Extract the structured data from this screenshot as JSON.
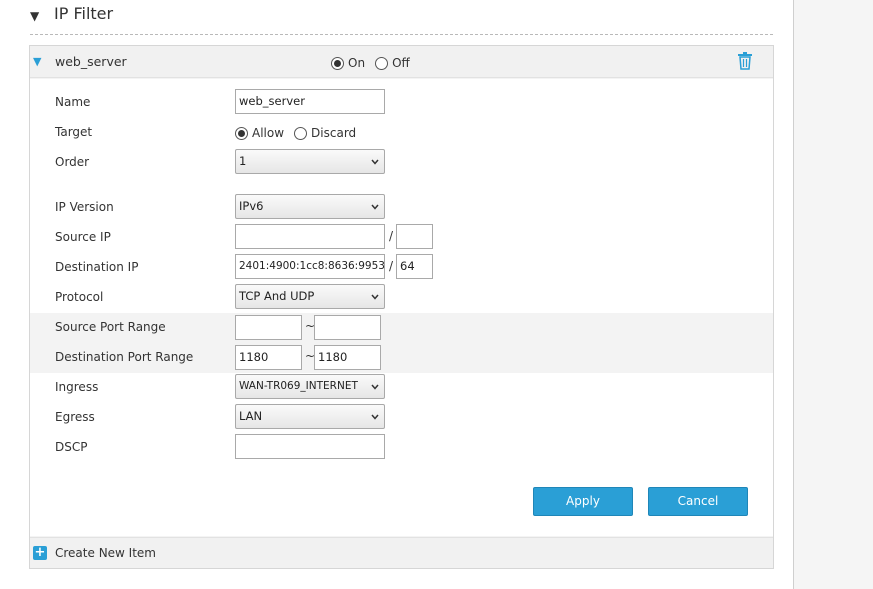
{
  "section": {
    "title": "IP Filter",
    "collapse_glyph": "▼"
  },
  "item": {
    "name": "web_server",
    "expand_glyph": "▼",
    "state_options": [
      {
        "label": "On",
        "checked": true
      },
      {
        "label": "Off",
        "checked": false
      }
    ],
    "delete_icon": "trash-icon"
  },
  "form": {
    "name": {
      "label": "Name",
      "value": "web_server"
    },
    "target": {
      "label": "Target",
      "options": [
        {
          "label": "Allow",
          "checked": true
        },
        {
          "label": "Discard",
          "checked": false
        }
      ]
    },
    "order": {
      "label": "Order",
      "value": "1"
    },
    "ip_version": {
      "label": "IP Version",
      "value": "IPv6"
    },
    "source_ip": {
      "label": "Source IP",
      "address": "",
      "prefix": "",
      "separator": "/"
    },
    "destination_ip": {
      "label": "Destination IP",
      "address": "2401:4900:1cc8:8636:9953",
      "prefix": "64",
      "separator": "/"
    },
    "protocol": {
      "label": "Protocol",
      "value": "TCP And UDP"
    },
    "source_port_range": {
      "label": "Source Port Range",
      "from": "",
      "to": "",
      "separator": "~"
    },
    "destination_port_range": {
      "label": "Destination Port Range",
      "from": "1180",
      "to": "1180",
      "separator": "~"
    },
    "ingress": {
      "label": "Ingress",
      "value": "WAN-TR069_INTERNET"
    },
    "egress": {
      "label": "Egress",
      "value": "LAN"
    },
    "dscp": {
      "label": "DSCP",
      "value": ""
    }
  },
  "buttons": {
    "apply": "Apply",
    "cancel": "Cancel"
  },
  "create": {
    "label": "Create New Item",
    "icon_glyph": "+"
  },
  "colors": {
    "accent": "#2a9fd6",
    "panel_bg": "#f4f4f4",
    "border": "#d6d6d6"
  }
}
